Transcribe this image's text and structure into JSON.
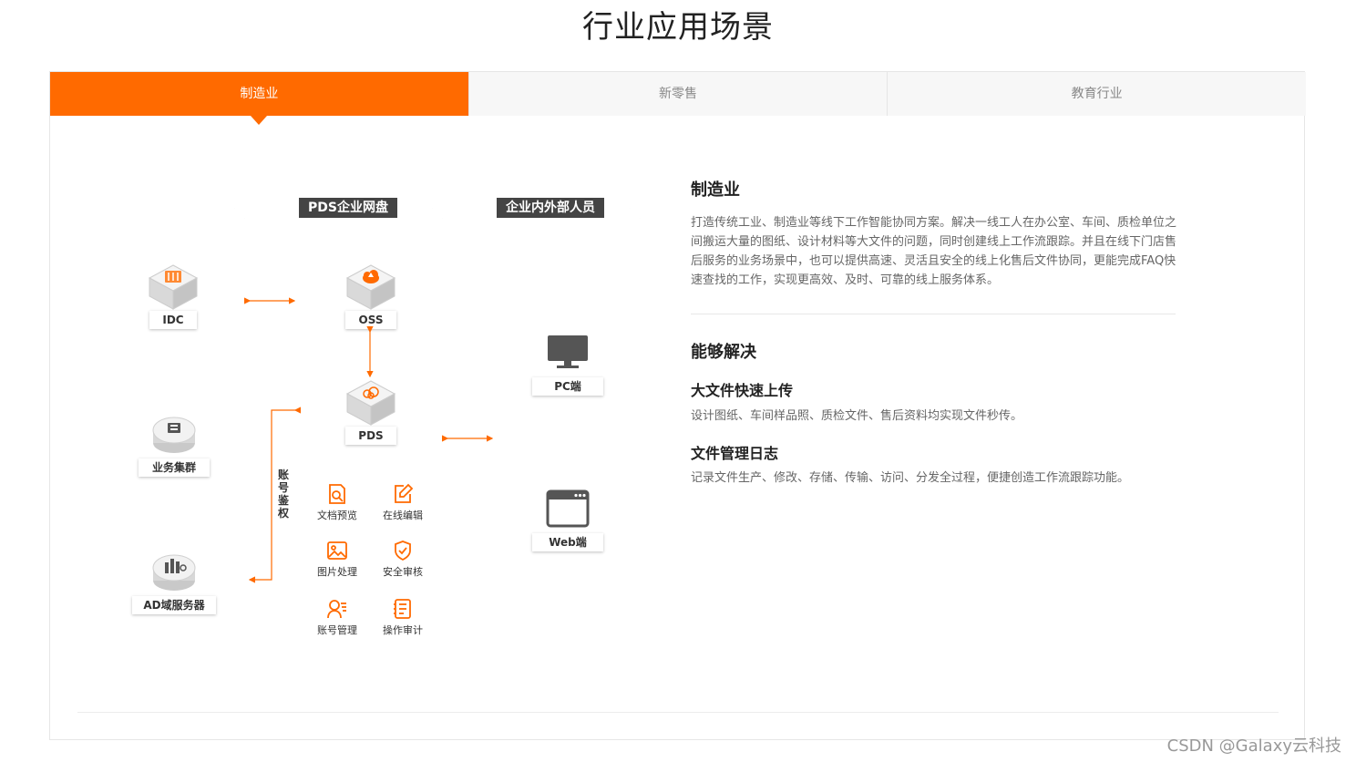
{
  "page_title": "行业应用场景",
  "tabs": [
    {
      "label": "制造业",
      "active": true
    },
    {
      "label": "新零售",
      "active": false
    },
    {
      "label": "教育行业",
      "active": false
    }
  ],
  "accent_color": "#ff6a00",
  "diagram": {
    "col_pds_title": "PDS企业网盘",
    "col_staff_title": "企业内外部人员",
    "left_nodes": [
      {
        "label": "IDC",
        "icon": "server-rack-icon"
      },
      {
        "label": "业务集群",
        "icon": "cluster-icon"
      },
      {
        "label": "AD域服务器",
        "icon": "domain-server-icon"
      }
    ],
    "pds_nodes": [
      {
        "label": "OSS",
        "icon": "cloud-storage-icon"
      },
      {
        "label": "PDS",
        "icon": "cloud-drive-icon"
      }
    ],
    "features": [
      {
        "label": "文档预览",
        "icon": "document-preview-icon"
      },
      {
        "label": "在线编辑",
        "icon": "edit-icon"
      },
      {
        "label": "图片处理",
        "icon": "image-icon"
      },
      {
        "label": "安全审核",
        "icon": "shield-check-icon"
      },
      {
        "label": "账号管理",
        "icon": "user-manage-icon"
      },
      {
        "label": "操作审计",
        "icon": "audit-log-icon"
      }
    ],
    "auth_label": "账号鉴权",
    "clients": [
      {
        "label": "PC端",
        "icon": "monitor-icon"
      },
      {
        "label": "Web端",
        "icon": "browser-window-icon"
      }
    ]
  },
  "content": {
    "title": "制造业",
    "description": "打造传统工业、制造业等线下工作智能协同方案。解决一线工人在办公室、车间、质检单位之间搬运大量的图纸、设计材料等大文件的问题，同时创建线上工作流跟踪。并且在线下门店售后服务的业务场景中，也可以提供高速、灵活且安全的线上化售后文件协同，更能完成FAQ快速查找的工作，实现更高效、及时、可靠的线上服务体系。",
    "solve_title": "能够解决",
    "items": [
      {
        "title": "大文件快速上传",
        "text": "设计图纸、车间样品照、质检文件、售后资料均实现文件秒传。"
      },
      {
        "title": "文件管理日志",
        "text": "记录文件生产、修改、存储、传输、访问、分发全过程，便捷创造工作流跟踪功能。"
      }
    ]
  },
  "watermark": "CSDN @Galaxy云科技"
}
